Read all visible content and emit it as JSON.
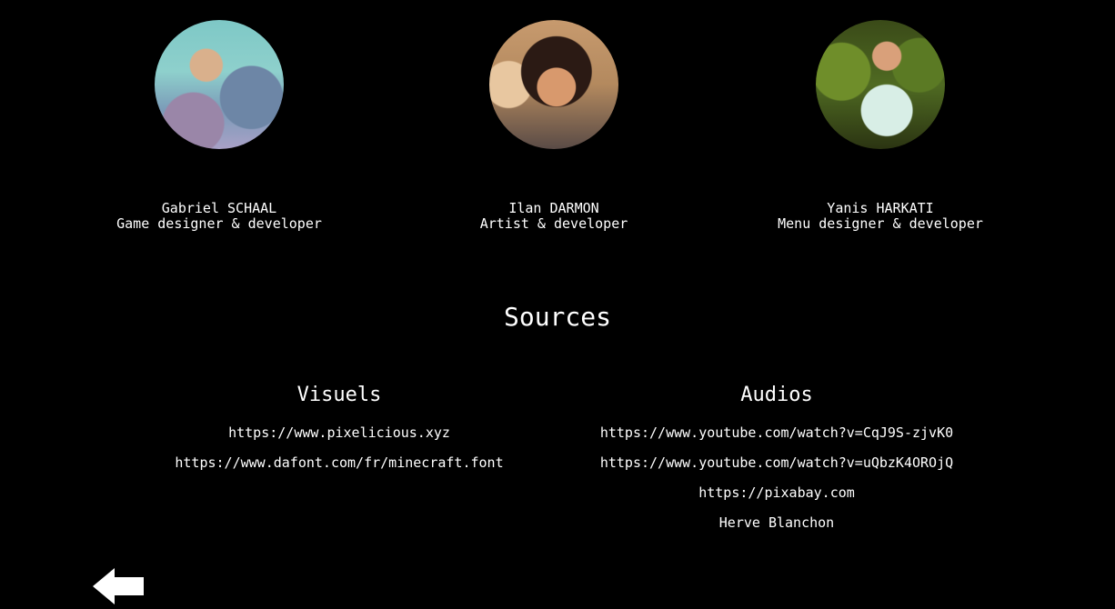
{
  "team": [
    {
      "name": "Gabriel SCHAAL",
      "role": "Game designer & developer"
    },
    {
      "name": "Ilan DARMON",
      "role": "Artist & developer"
    },
    {
      "name": "Yanis HARKATI",
      "role": "Menu designer & developer"
    }
  ],
  "sources": {
    "title": "Sources",
    "visuels": {
      "title": "Visuels",
      "links": [
        "https://www.pixelicious.xyz",
        "https://www.dafont.com/fr/minecraft.font"
      ]
    },
    "audios": {
      "title": "Audios",
      "links": [
        "https://www.youtube.com/watch?v=CqJ9S-zjvK0",
        "https://www.youtube.com/watch?v=uQbzK4OROjQ",
        "https://pixabay.com",
        "Herve Blanchon"
      ]
    }
  },
  "icons": {
    "back": "arrow-left-icon"
  },
  "colors": {
    "background": "#000000",
    "text": "#ffffff"
  }
}
